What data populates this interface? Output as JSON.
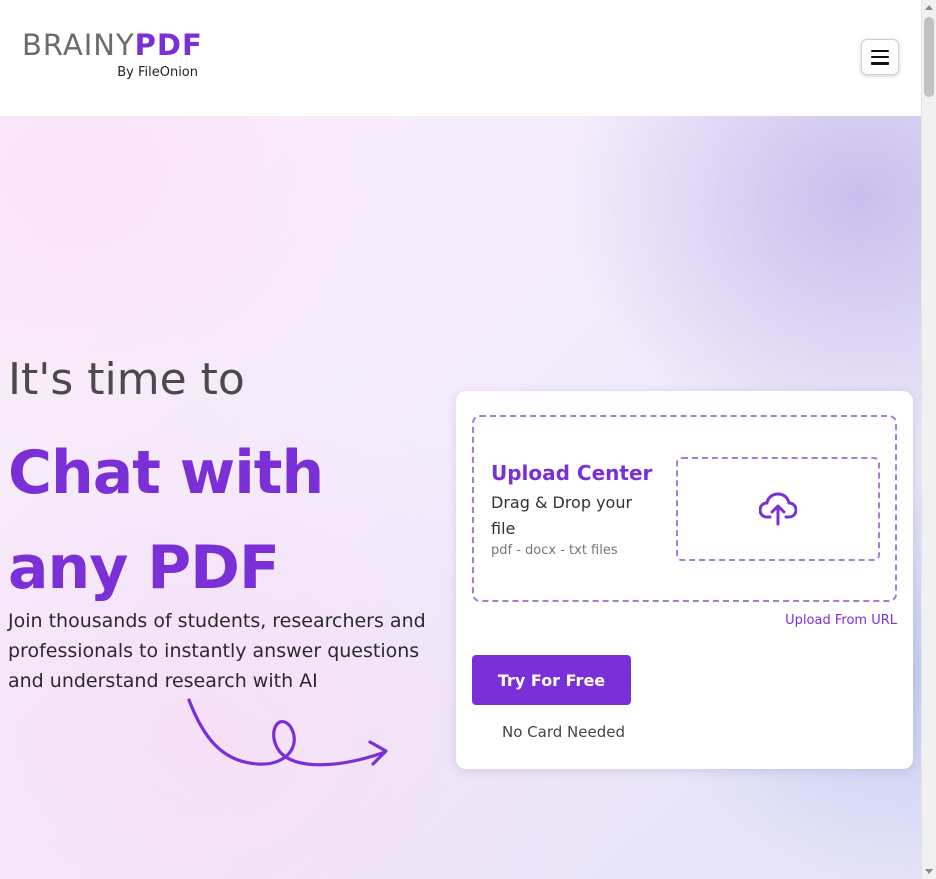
{
  "header": {
    "logo": {
      "brand_part1": "BRAINY",
      "brand_part2": "PDF",
      "tagline": "By FileOnion"
    },
    "menu_icon": "hamburger-menu-icon"
  },
  "hero": {
    "line1": "It's time to",
    "line2": "Chat with any PDF",
    "description": "Join thousands of students, researchers and professionals to instantly answer questions and understand research with AI",
    "arrow_icon": "curly-arrow-icon"
  },
  "upload_card": {
    "title": "Upload Center",
    "subtitle": "Drag & Drop your file",
    "formats": "pdf - docx - txt files",
    "upload_icon": "cloud-upload-icon",
    "url_link": "Upload From URL",
    "cta_label": "Try For Free",
    "cta_note": "No Card Needed"
  },
  "colors": {
    "accent": "#7b2fd6",
    "dashed_border": "#a77bd8",
    "text_dark": "#2a2a2a",
    "logo_gray": "#6b6b6b"
  }
}
